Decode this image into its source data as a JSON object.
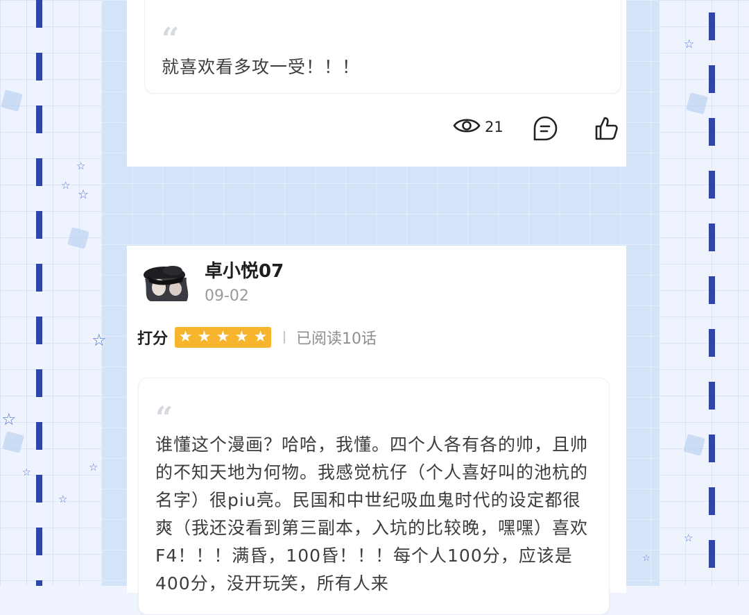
{
  "first_review": {
    "text": "就喜欢看多攻一受！！！",
    "views": "21"
  },
  "second_review": {
    "username": "卓小悦07",
    "date": "09-02",
    "rating_label": "打分",
    "rating_stars": 5,
    "read_status": "已阅读10话",
    "text": "谁懂这个漫画？哈哈，我懂。四个人各有各的帅，且帅的不知天地为何物。我感觉杭仔（个人喜好叫的池杭的名字）很piu亮。民国和中世纪吸血鬼时代的设定都很爽（我还没看到第三副本，入坑的比较晚，嘿嘿）喜欢F4！！！满昏，100昏！！！每个人100分，应该是400分，没开玩笑，所有人来"
  },
  "icons": {
    "views": "eye-icon",
    "comment": "comment-icon",
    "like": "thumbs-up-icon",
    "quote": "quote-icon",
    "star": "star-icon"
  },
  "colors": {
    "accent_blue": "#2f45a8",
    "star_gold": "#f6b52c"
  }
}
